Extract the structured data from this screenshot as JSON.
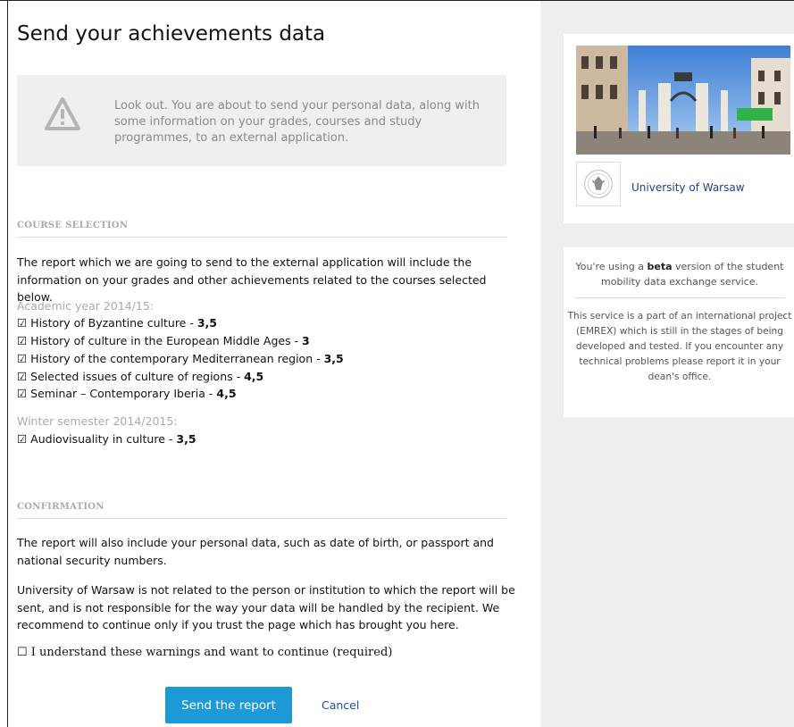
{
  "page_title": "Send your achievements data",
  "warning": "Look out. You are about to send your personal data, along with some information on your grades, courses and study programmes, to an external application.",
  "course_selection": {
    "heading": "COURSE SELECTION",
    "intro": "The report which we are going to send to the external application will include the information on your grades and other achievements related to the courses selected below.",
    "groups": [
      {
        "label": "Academic year 2014/15:",
        "courses": [
          {
            "name": "☑ History of Byzantine culture - ",
            "grade": "3,5"
          },
          {
            "name": "☑ History of culture in the European Middle Ages - ",
            "grade": "3"
          },
          {
            "name": "☑ History of the contemporary Mediterranean region - ",
            "grade": "3,5"
          },
          {
            "name": "☑ Selected issues of culture of regions - ",
            "grade": "4,5"
          },
          {
            "name": "☑ Seminar – Contemporary Iberia - ",
            "grade": "4,5"
          }
        ]
      },
      {
        "label": "Winter semester 2014/2015:",
        "courses": [
          {
            "name": "☑ Audiovisuality in culture - ",
            "grade": "3,5"
          }
        ]
      }
    ]
  },
  "confirmation": {
    "heading": "CONFIRMATION",
    "para1": "The report will also include your personal data, such as date of birth, or passport and national security numbers.",
    "para2": "University of Warsaw is not related to the person or institution to which the report will be sent, and is not responsible for the way your data will be handled by the recipient. We recommend to continue only if you trust the page which has brought you here.",
    "checkbox_label": "☐ I understand these warnings and want to continue (required)"
  },
  "actions": {
    "send_label": "Send the report",
    "cancel_label": "Cancel",
    "accent": "#1d9ad6"
  },
  "sidebar": {
    "university_name": "University of Warsaw",
    "beta_pre": "You're using a ",
    "beta_word": "beta",
    "beta_post": " version of the student mobility data exchange service.",
    "project_note": "This service is a part of an international project (EMREX) which is still in the stages of being developed and tested. If you encounter any technical problems please report it in your dean's office."
  }
}
